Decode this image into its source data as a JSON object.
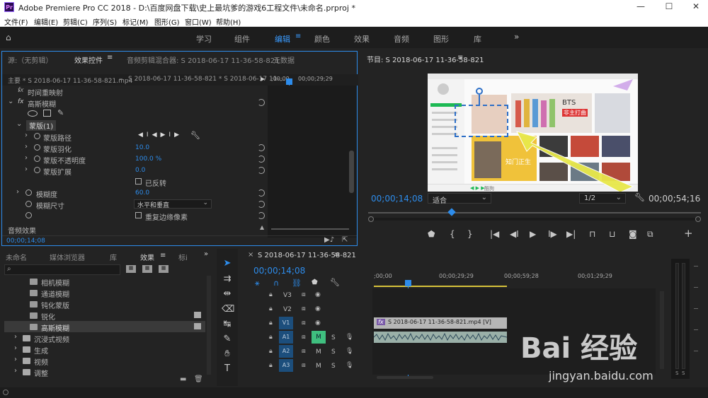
{
  "window": {
    "title": "Adobe Premiere Pro CC 2018 - D:\\百度网盘下载\\史上最坑爹的游戏6工程文件\\未命名.prproj *",
    "logo": "Pr",
    "minimize": "—",
    "maximize": "☐",
    "close": "✕"
  },
  "menu": [
    "文件(F)",
    "编辑(E)",
    "剪辑(C)",
    "序列(S)",
    "标记(M)",
    "图形(G)",
    "窗口(W)",
    "帮助(H)"
  ],
  "workspaces": [
    "学习",
    "组件",
    "编辑",
    "颜色",
    "效果",
    "音频",
    "图形",
    "库"
  ],
  "effect_controls": {
    "tabs": [
      "源:（无剪辑）",
      "效果控件",
      "音频剪辑混合器: S 2018-06-17 11-36-58-821",
      "元数据"
    ],
    "master": "主要 * S 2018-06-17 11-36-58-821.mp4",
    "sequence": "S 2018-06-17 11-36-58-821 * S 2018-06-17 11-...",
    "ruler": [
      ";00;00",
      "00;00;29;29"
    ],
    "time_remap": "时间重映射",
    "fx": "fx",
    "effect": "高斯模糊",
    "mask": "蒙版(1)",
    "mask_path": "蒙版路径",
    "mask_feather": {
      "label": "蒙版羽化",
      "value": "10.0"
    },
    "mask_opacity": {
      "label": "蒙版不透明度",
      "value": "100.0 %"
    },
    "mask_expand": {
      "label": "蒙版扩展",
      "value": "0.0"
    },
    "inverted": "已反转",
    "blurriness": {
      "label": "模糊度",
      "value": "60.0"
    },
    "blur_dimensions": {
      "label": "模糊尺寸",
      "value": "水平和垂直"
    },
    "repeat_edge": "重复边缘像素",
    "audio_effects": "音频效果",
    "timecode": "00;00;14;08"
  },
  "program": {
    "title": "节目: S 2018-06-17 11-36-58-821",
    "timecode": "00;00;14;08",
    "fit": "适合",
    "resolution": "1/2",
    "duration": "00;00;54;16",
    "frame_text": {
      "bts": "BTS",
      "sub": "非主打曲",
      "album": "知门正生",
      "user": "酷狗"
    }
  },
  "effects_panel": {
    "tabs": [
      "未命名",
      "媒体浏览器",
      "库",
      "效果",
      "标i"
    ],
    "items": [
      {
        "label": "相机模糊",
        "level": 2
      },
      {
        "label": "通道模糊",
        "level": 2
      },
      {
        "label": "钝化蒙版",
        "level": 2
      },
      {
        "label": "锐化",
        "level": 2
      },
      {
        "label": "高斯模糊",
        "level": 2,
        "selected": true
      },
      {
        "label": "沉浸式视频",
        "level": 1
      },
      {
        "label": "生成",
        "level": 1
      },
      {
        "label": "视频",
        "level": 1
      },
      {
        "label": "调整",
        "level": 1
      }
    ]
  },
  "timeline": {
    "tab": "S 2018-06-17 11-36-58-821",
    "timecode": "00;00;14;08",
    "ruler": [
      ";00;00",
      "00;00;29;29",
      "00;00;59;28",
      "00;01;29;29"
    ],
    "tracks": [
      {
        "name": "V3",
        "id": "V3"
      },
      {
        "name": "V2",
        "id": "V2"
      },
      {
        "name": "V1",
        "id": "V1",
        "clip": "S 2018-06-17 11-36-58-821.mp4 [V]"
      },
      {
        "name": "A1",
        "id": "A1",
        "m": "M",
        "s": "S"
      },
      {
        "name": "A2",
        "id": "A2",
        "m": "M",
        "s": "S"
      },
      {
        "name": "A3",
        "id": "A3",
        "m": "M",
        "s": "S"
      }
    ],
    "fx_badge": "fx"
  },
  "meter": {
    "labels": [
      "S",
      "S"
    ]
  },
  "watermark": {
    "text": "Bai 经验",
    "url": "jingyan.baidu.com"
  },
  "colors": {
    "accent": "#2d8ceb",
    "clip": "#b6b6b6",
    "bg": "#232323"
  }
}
